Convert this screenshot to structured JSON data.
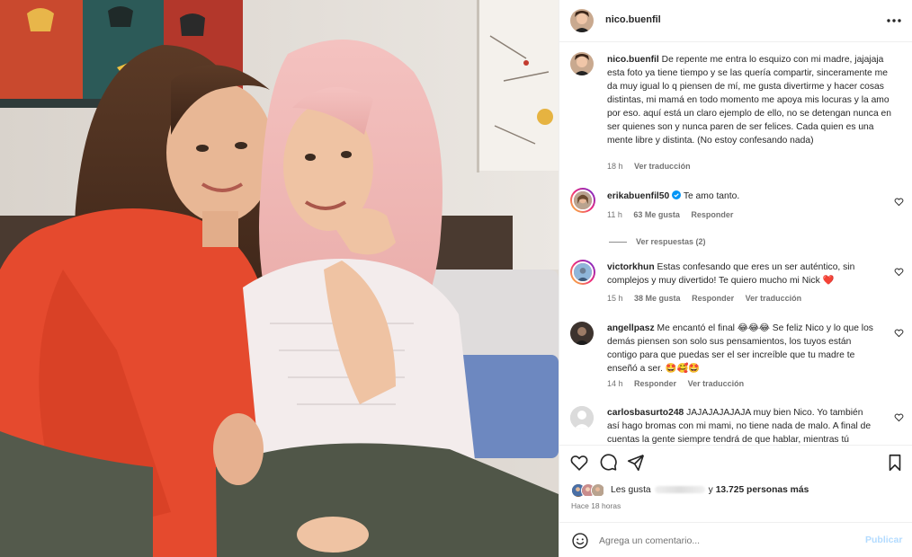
{
  "post": {
    "username": "nico.buenfil",
    "caption": "De repente me entra lo esquizo con mi madre, jajajaja esta foto ya tiene tiempo y se las quería compartir, sinceramente me da muy igual lo q piensen de mí, me gusta divertirme y hacer cosas distintas, mi mamá en todo momento me apoya mis locuras y la amo por eso. aquí está un claro ejemplo de ello, no se detengan nunca en ser quienes son y nunca paren de ser felices. Cada quien es una mente libre y distinta. (No estoy confesando nada)",
    "caption_time": "18 h",
    "caption_translate": "Ver traducción"
  },
  "comments": [
    {
      "username": "erikabuenfil50",
      "verified": true,
      "text": "Te amo tanto.",
      "time": "11 h",
      "likes": "63 Me gusta",
      "reply": "Responder",
      "view_replies": "Ver respuestas (2)"
    },
    {
      "username": "victorkhun",
      "text": "Estas confesando que eres un ser auténtico, sin complejos y muy divertido! Te quiero mucho mi Nick ❤️",
      "time": "15 h",
      "likes": "38 Me gusta",
      "reply": "Responder",
      "translate": "Ver traducción"
    },
    {
      "username": "angellpasz",
      "text": "Me encantó el final 😂😂😂 Se feliz Nico y lo que los demás piensen son solo sus pensamientos, los tuyos están contigo para que puedas ser el ser increíble que tu madre te enseñó a ser. 🤩🥰🤩",
      "time": "14 h",
      "reply": "Responder",
      "translate": "Ver traducción"
    },
    {
      "username": "carlosbasurto248",
      "text": "JAJAJAJAJAJA muy bien Nico. Yo también así hago bromas con mi mami, no tiene nada de malo. A final de cuentas la gente siempre tendrá de que hablar, mientras tú"
    }
  ],
  "likes": {
    "prefix": "Les gusta",
    "count_text": "13.725 personas más",
    "connector": "y"
  },
  "time_ago": "Hace 18 horas",
  "composer": {
    "placeholder": "Agrega un comentario...",
    "publish": "Publicar"
  },
  "icons": {
    "more": "more-horizontal-icon",
    "like": "heart-icon",
    "comment": "comment-icon",
    "share": "share-icon",
    "save": "bookmark-icon",
    "emoji": "emoji-icon"
  },
  "colors": {
    "verified": "#0095f6",
    "heart_red": "#ed4956",
    "publish_disabled": "#b3dbff",
    "meta_gray": "#737373"
  }
}
